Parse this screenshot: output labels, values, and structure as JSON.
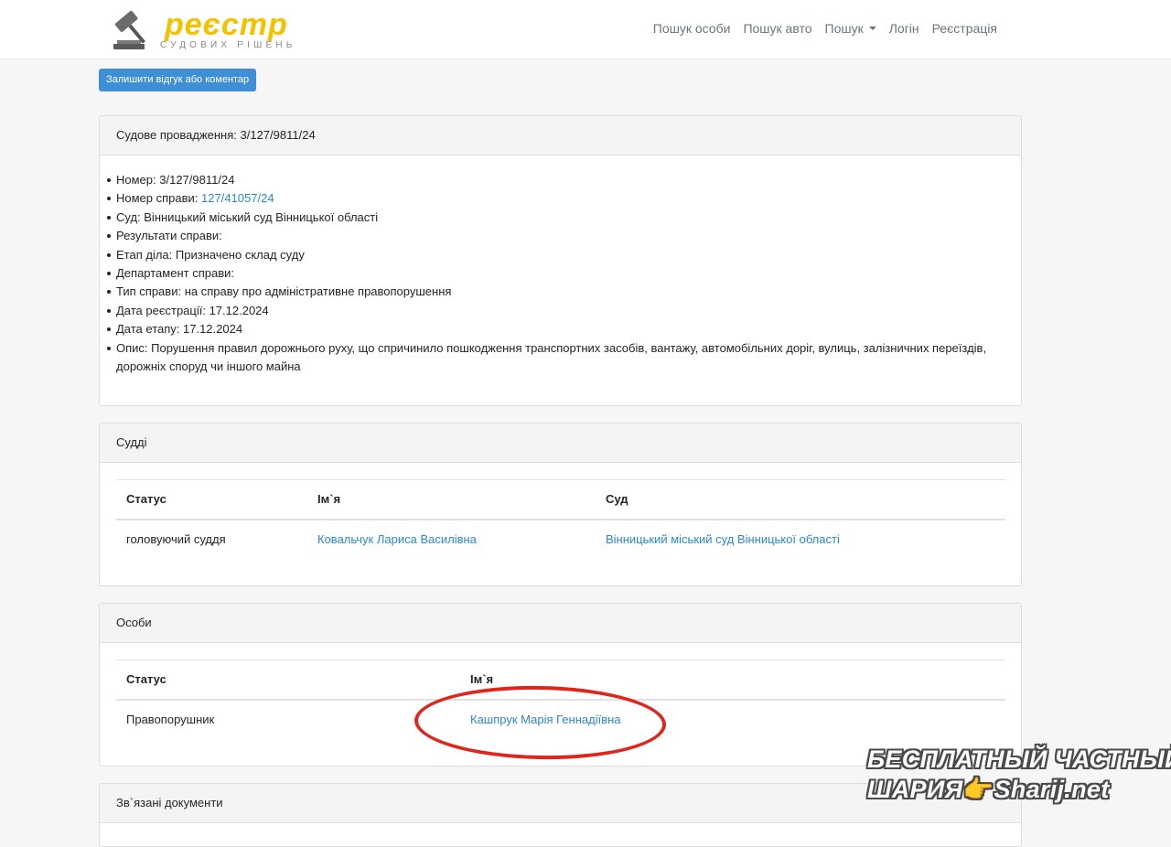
{
  "brand": {
    "title": "реєстр",
    "subtitle": "СУДОВИХ РІШЕНЬ"
  },
  "nav": {
    "items": [
      "Пошук особи",
      "Пошук авто",
      "Пошук",
      "Логін",
      "Реєстрація"
    ]
  },
  "feedback_button": "Залишити відгук або коментар",
  "proceeding": {
    "header": "Судове провадження: 3/127/9811/24",
    "number_label": "Номер: ",
    "number_value": "3/127/9811/24",
    "case_label": "Номер справи: ",
    "case_value": "127/41057/24",
    "court_label": "Суд: ",
    "court_value": "Вінницький міський суд Вінницької області",
    "results_label": "Результати справи:",
    "stage_label": "Етап діла: ",
    "stage_value": "Призначено склад суду",
    "department_label": "Департамент справи:",
    "type_label": "Тип справи: ",
    "type_value": "на справу про адміністративне правопорушення",
    "reg_date_label": "Дата реєстрації: ",
    "reg_date_value": "17.12.2024",
    "stage_date_label": "Дата етапу: ",
    "stage_date_value": "17.12.2024",
    "description_label": "Опис: ",
    "description_value": "Порушення правил дорожнього руху, що спричинило пошкодження транспортних засобів, вантажу, автомобільних доріг, вулиць, залізничних переїздів, дорожніх споруд чи іншого майна"
  },
  "judges": {
    "header": "Судді",
    "columns": [
      "Статус",
      "Ім`я",
      "Суд"
    ],
    "rows": [
      {
        "status": "головуючий суддя",
        "name": "Ковальчук Лариса Василівна",
        "court": "Вінницький міський суд Вінницької області"
      }
    ]
  },
  "persons": {
    "header": "Особи",
    "columns": [
      "Статус",
      "Ім`я"
    ],
    "rows": [
      {
        "status": "Правопорушник",
        "name": "Кашпрук Марія Геннадіївна"
      }
    ]
  },
  "related": {
    "header": "Зв`язані документи"
  },
  "watermark": {
    "line1": "БЕСПЛАТНЫЙ ЧАСТНЫЙ",
    "line2_left": "ШАРИЯ",
    "line2_right": "Sharij.net"
  },
  "colors": {
    "link": "#2a88d0",
    "button": "#3f8fd6",
    "brand": "#f2c200",
    "annotation": "#e0251d"
  }
}
